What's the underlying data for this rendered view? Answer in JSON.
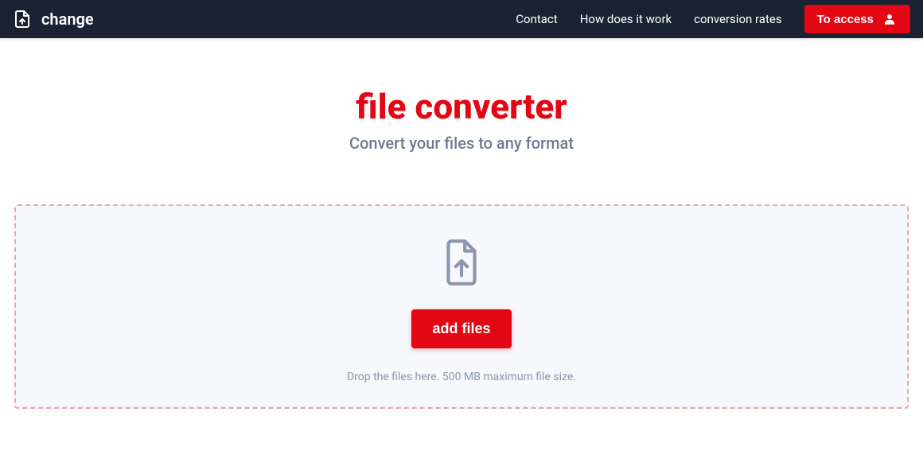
{
  "header": {
    "logo_text": "change",
    "nav": {
      "contact": "Contact",
      "how_it_works": "How does it work",
      "conversion_rates": "conversion rates"
    },
    "access_button": "To access"
  },
  "main": {
    "title": "file converter",
    "subtitle": "Convert your files to any format",
    "add_files_button": "add files",
    "dropzone_hint": "Drop the files here. 500 MB maximum file size."
  },
  "colors": {
    "brand_red": "#e30613",
    "header_bg": "#1a2332",
    "subtitle_gray": "#6b7a94",
    "hint_gray": "#8a96ac",
    "dropzone_bg": "#f6f8fb",
    "dropzone_border": "#f5a0a5"
  }
}
